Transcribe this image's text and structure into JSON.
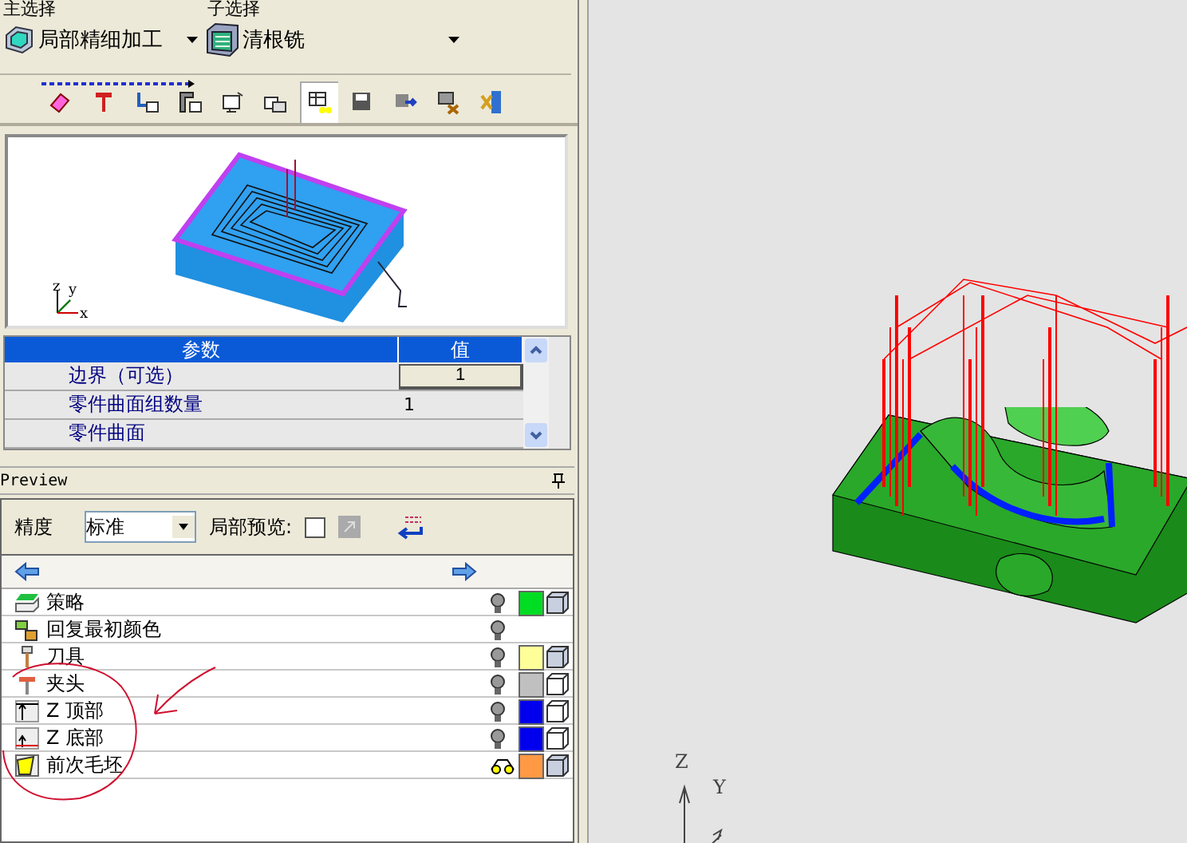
{
  "selection_labels": [
    "主选择",
    "子选择"
  ],
  "strategies": [
    {
      "label": "局部精细加工",
      "kind": "local"
    },
    {
      "label": "清根铣",
      "kind": "pencil"
    }
  ],
  "toolbar": [
    {
      "selected": false
    },
    {
      "selected": false
    },
    {
      "selected": false
    },
    {
      "selected": false
    },
    {
      "selected": false
    },
    {
      "selected": false
    },
    {
      "selected": true
    },
    {
      "selected": false
    },
    {
      "selected": false
    },
    {
      "selected": false
    },
    {
      "selected": false
    }
  ],
  "thumbnail": {
    "axes": [
      "z",
      "y",
      "x"
    ]
  },
  "params": {
    "columns": [
      "参数",
      "值"
    ],
    "rows": [
      {
        "name": "边界（可选）",
        "value": "1",
        "kind": "button"
      },
      {
        "name": "零件曲面组数量",
        "value": "1",
        "kind": "text"
      },
      {
        "name": "零件曲面"
      }
    ]
  },
  "preview": {
    "title": "Preview",
    "precision_label": "精度",
    "precision": "标准",
    "local_label": "局部预览:",
    "local_checked": false
  },
  "layers": [
    {
      "label": "策略",
      "kind": "strategy",
      "glasses": false,
      "color": "#00dd22",
      "wireframe": false
    },
    {
      "label": "回复最初颜色",
      "kind": "reset",
      "glasses": false
    },
    {
      "label": "刀具",
      "kind": "tool",
      "glasses": false,
      "color": "#ffff99",
      "wireframe": false
    },
    {
      "label": "夹头",
      "kind": "holder",
      "glasses": false,
      "color": "#c0c0c0",
      "wireframe": true
    },
    {
      "label": "Z 顶部",
      "kind": "ztop",
      "glasses": false,
      "color": "#0000ee",
      "wireframe": true
    },
    {
      "label": "Z 底部",
      "kind": "zbottom",
      "glasses": false,
      "color": "#0000ee",
      "wireframe": true
    },
    {
      "label": "前次毛坯",
      "kind": "stock",
      "glasses": true,
      "color": "#ff9944",
      "wireframe": false
    }
  ],
  "viewport": {
    "axes": [
      "Z",
      "Y"
    ]
  }
}
